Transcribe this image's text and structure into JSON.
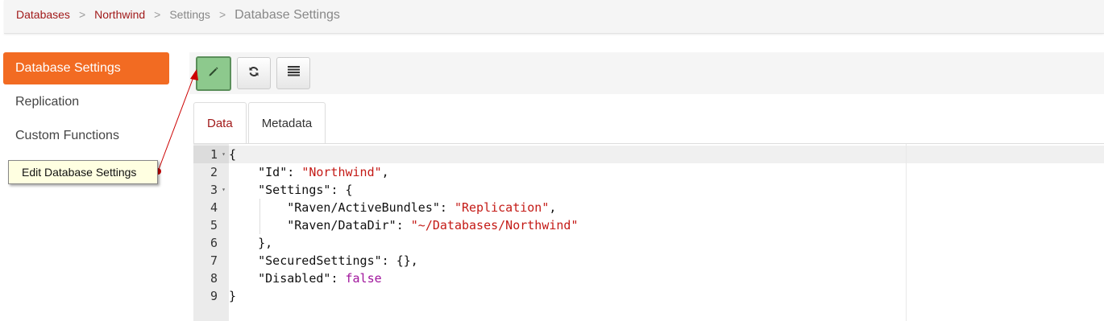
{
  "breadcrumb": {
    "items": [
      "Databases",
      "Northwind",
      "Settings",
      "Database Settings"
    ],
    "separator": ">"
  },
  "sidebar": {
    "items": [
      {
        "label": "Database Settings",
        "active": true
      },
      {
        "label": "Replication",
        "active": false
      },
      {
        "label": "Custom Functions",
        "active": false
      }
    ]
  },
  "tooltip": {
    "text": "Edit Database Settings"
  },
  "toolbar": {
    "buttons": [
      {
        "icon": "pencil-icon",
        "title": "Edit"
      },
      {
        "icon": "refresh-icon",
        "title": "Refresh"
      },
      {
        "icon": "list-icon",
        "title": "Menu"
      }
    ]
  },
  "tabs": [
    {
      "label": "Data",
      "active": true
    },
    {
      "label": "Metadata",
      "active": false
    }
  ],
  "editor": {
    "line_numbers": [
      "1",
      "2",
      "3",
      "4",
      "5",
      "6",
      "7",
      "8",
      "9"
    ],
    "lines": [
      [
        {
          "t": "{",
          "c": "p"
        }
      ],
      [
        {
          "t": "    ",
          "c": "p"
        },
        {
          "t": "\"Id\"",
          "c": "k"
        },
        {
          "t": ": ",
          "c": "p"
        },
        {
          "t": "\"Northwind\"",
          "c": "s"
        },
        {
          "t": ",",
          "c": "p"
        }
      ],
      [
        {
          "t": "    ",
          "c": "p"
        },
        {
          "t": "\"Settings\"",
          "c": "k"
        },
        {
          "t": ": {",
          "c": "p"
        }
      ],
      [
        {
          "t": "        ",
          "c": "p"
        },
        {
          "t": "\"Raven/ActiveBundles\"",
          "c": "k"
        },
        {
          "t": ": ",
          "c": "p"
        },
        {
          "t": "\"Replication\"",
          "c": "s"
        },
        {
          "t": ",",
          "c": "p"
        }
      ],
      [
        {
          "t": "        ",
          "c": "p"
        },
        {
          "t": "\"Raven/DataDir\"",
          "c": "k"
        },
        {
          "t": ": ",
          "c": "p"
        },
        {
          "t": "\"~/Databases/Northwind\"",
          "c": "s"
        }
      ],
      [
        {
          "t": "    },",
          "c": "p"
        }
      ],
      [
        {
          "t": "    ",
          "c": "p"
        },
        {
          "t": "\"SecuredSettings\"",
          "c": "k"
        },
        {
          "t": ": {},",
          "c": "p"
        }
      ],
      [
        {
          "t": "    ",
          "c": "p"
        },
        {
          "t": "\"Disabled\"",
          "c": "k"
        },
        {
          "t": ": ",
          "c": "p"
        },
        {
          "t": "false",
          "c": "b"
        }
      ],
      [
        {
          "t": "}",
          "c": "p"
        }
      ]
    ],
    "foldable_lines": [
      1,
      3
    ]
  },
  "colors": {
    "accent": "#f26b22",
    "link": "#a11a1a",
    "edit_button": "#8dc98d",
    "string": "#c41a16",
    "boolean": "#a0149c",
    "tooltip_bg": "#ffffe1"
  }
}
